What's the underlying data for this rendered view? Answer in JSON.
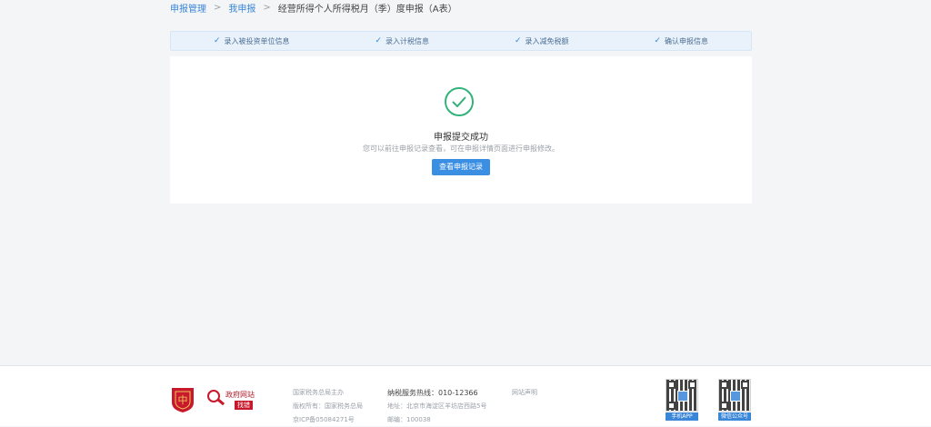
{
  "breadcrumb": {
    "items": [
      "申报管理",
      "我申报",
      "经营所得个人所得税月（季）度申报（A表）"
    ],
    "separator": ">"
  },
  "steps": [
    {
      "label": "录入被投资单位信息"
    },
    {
      "label": "录入计税信息"
    },
    {
      "label": "录入减免税额"
    },
    {
      "label": "确认申报信息"
    }
  ],
  "result": {
    "title": "申报提交成功",
    "description": "您可以前往申报记录查看，可在申报详情页面进行申报修改。",
    "button": "查看申报记录"
  },
  "footer": {
    "gov_logo": {
      "line1": "政府网站",
      "line2": "找错"
    },
    "col1": [
      "国家税务总局主办",
      "版权所有：国家税务总局",
      "京ICP备05084271号"
    ],
    "col2": [
      "纳税服务热线：010-12366",
      "地址：北京市海淀区羊坊店西路5号",
      "邮编：100038"
    ],
    "col3": [
      "网站声明"
    ],
    "qr_captions": [
      "手机APP",
      "微信公众号"
    ]
  },
  "colors": {
    "accent": "#3b8fe3",
    "success": "#33b27a",
    "gov_red": "#c8182c"
  }
}
